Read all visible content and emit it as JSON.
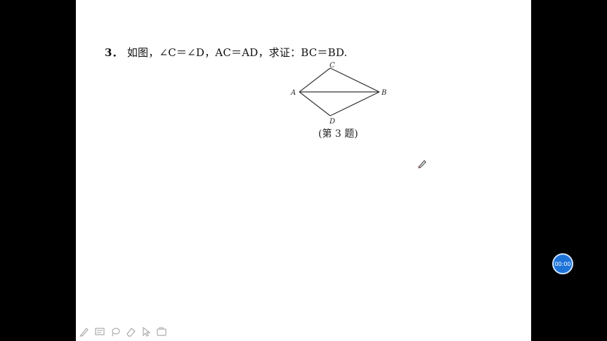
{
  "problem": {
    "number": "3．",
    "text": "如图，∠C＝∠D，AC＝AD，求证：BC＝BD."
  },
  "figure": {
    "labels": {
      "A": "A",
      "B": "B",
      "C": "C",
      "D": "D"
    },
    "caption": "(第 3 题)"
  },
  "timer": {
    "label": "00:00",
    "color": "#1e73d9"
  },
  "toolbar": {
    "tools": [
      "pen-icon",
      "slide-icon",
      "lasso-icon",
      "eraser-icon",
      "pointer-icon",
      "camera-icon"
    ]
  }
}
